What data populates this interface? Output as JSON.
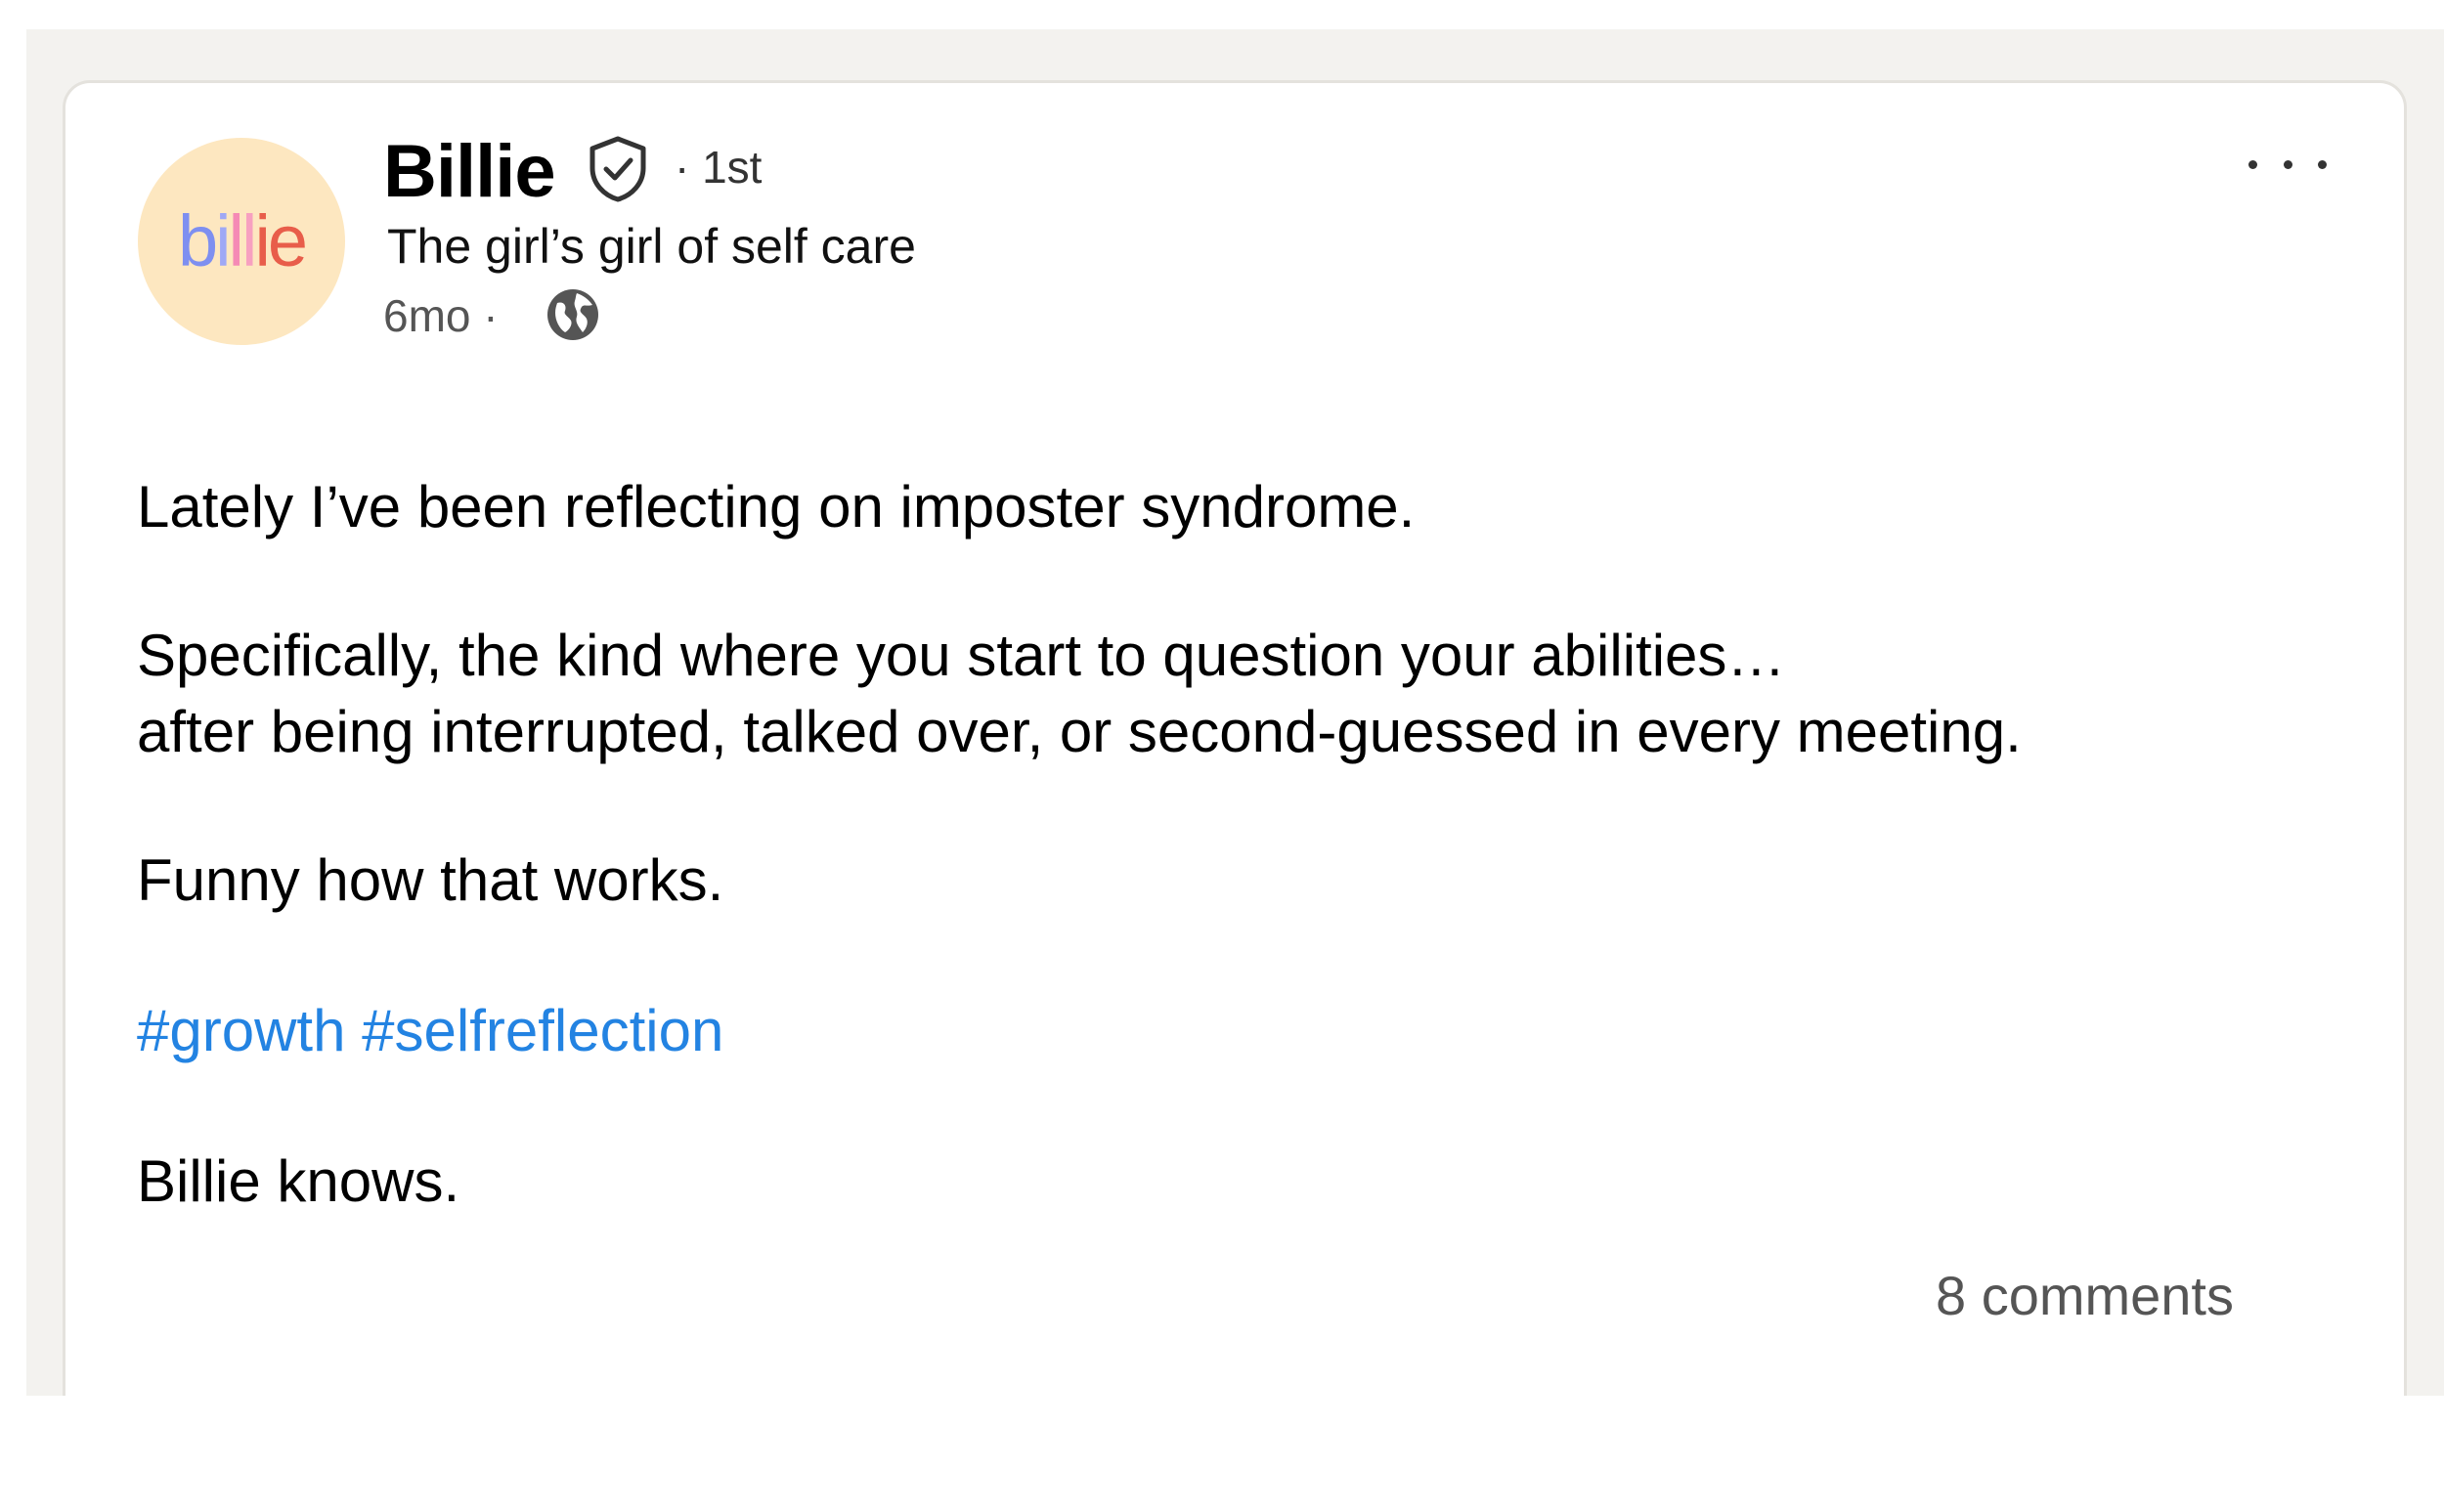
{
  "post": {
    "author": {
      "name": "Billie",
      "connection_degree": "· 1st",
      "headline": "The girl’s girl of self care",
      "time": "6mo ·",
      "avatar_text": {
        "l1": "b",
        "l2": "i",
        "l3": "l",
        "l4": "l",
        "l5": "i",
        "l6": "e"
      }
    },
    "icons": {
      "verified": "verified-shield-icon",
      "visibility": "globe-icon",
      "menu": "more-options-icon"
    },
    "body": {
      "paragraph_1": "Lately I’ve been reflecting on imposter syndrome.",
      "paragraph_2_line_1": "Specifically, the kind where you start to question your abilities…",
      "paragraph_2_line_2": "after being interrupted, talked over, or second-guessed in every meeting.",
      "paragraph_3": "Funny how that works.",
      "hashtags": [
        "#growth",
        "#selfreflection"
      ],
      "paragraph_5": "Billie knows."
    },
    "comments_label": "8 comments"
  },
  "colors": {
    "backdrop": "#f3f2ef",
    "card": "#ffffff",
    "hashtag": "#2383e2",
    "avatar_bg": "#fde7c0"
  }
}
